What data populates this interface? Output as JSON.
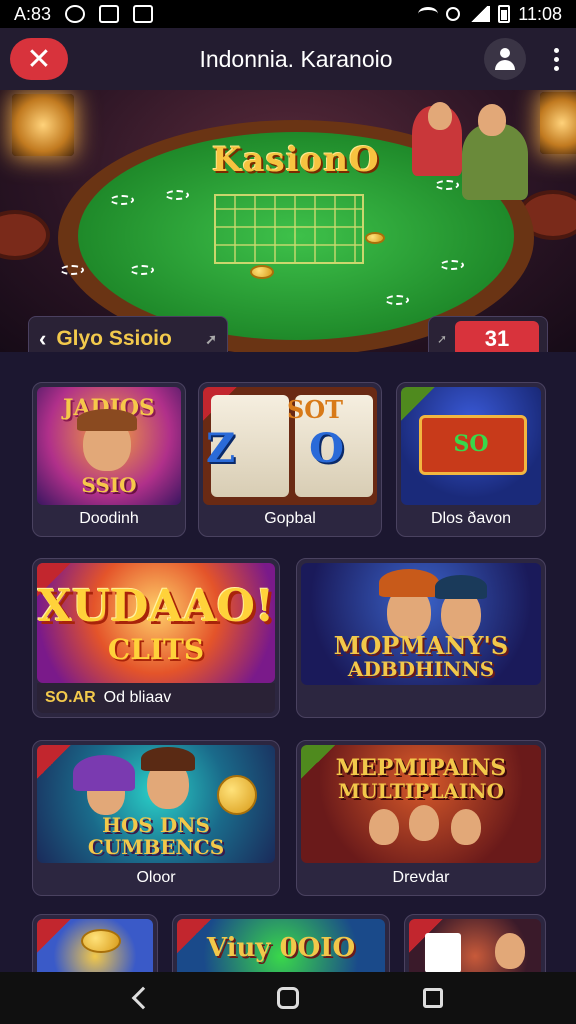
{
  "status_bar": {
    "time_left": "A:83",
    "time_right": "11:08"
  },
  "header": {
    "title": "Indonnia. Karanoio"
  },
  "hero": {
    "banner_title": "KasionO",
    "search_label": "Glyo Ssioio",
    "counter_value": "31"
  },
  "games": [
    {
      "label": "Doodinh",
      "art_text": "JADIOS",
      "art_subtext": "SSIO"
    },
    {
      "label": "Gopbal",
      "art_text": "SOT",
      "art_subtext": "Z O"
    },
    {
      "label": "Dlos ðavon",
      "art_text": "SO"
    },
    {
      "label": "Od bliaav",
      "accent": "SO.AR",
      "art_text": "XUDAAO!",
      "art_subtext": "CLITS"
    },
    {
      "label": "",
      "art_text": "MOPMANY'S",
      "art_subtext": "ADBDHINNS"
    },
    {
      "label": "Oloor",
      "art_text": "HOS DNS",
      "art_subtext": "CUMBENCS"
    },
    {
      "label": "Drevdar",
      "art_text": "MEPMIPAINS",
      "art_subtext": "MULTIPLAINO"
    },
    {
      "label": "",
      "art_text": ""
    },
    {
      "label": "",
      "art_text": "Viuy 0OIO"
    },
    {
      "label": "",
      "art_text": ""
    }
  ]
}
